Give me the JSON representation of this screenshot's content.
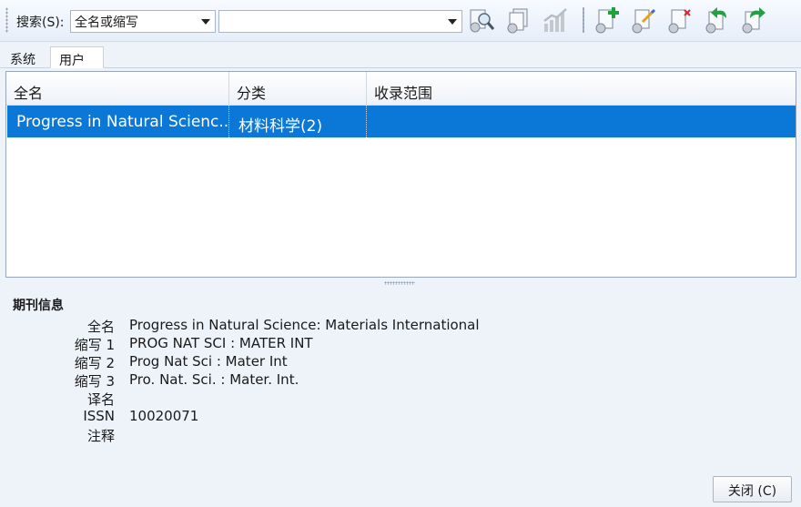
{
  "toolbar": {
    "search_label": "搜索(S):",
    "search_field_value": "全名或缩写",
    "search_text_value": "",
    "buttons": [
      {
        "name": "search-icon",
        "interactable": true
      },
      {
        "name": "copy-icon",
        "interactable": true
      },
      {
        "name": "chart-icon",
        "interactable": false
      },
      {
        "name": "add-icon",
        "interactable": true
      },
      {
        "name": "edit-icon",
        "interactable": true
      },
      {
        "name": "delete-icon",
        "interactable": true
      },
      {
        "name": "import-icon",
        "interactable": true
      },
      {
        "name": "export-icon",
        "interactable": true
      }
    ]
  },
  "tabs": [
    {
      "label": "系统",
      "active": false
    },
    {
      "label": "用户",
      "active": true
    }
  ],
  "table": {
    "columns": [
      "全名",
      "分类",
      "收录范围"
    ],
    "rows": [
      {
        "full_name": "Progress in Natural Scienc...",
        "category": "材料科学(2)",
        "scope": ""
      }
    ]
  },
  "info": {
    "title": "期刊信息",
    "fields": [
      {
        "label": "全名",
        "value": "Progress in Natural Science: Materials International"
      },
      {
        "label": "缩写 1",
        "value": "PROG NAT SCI : MATER INT"
      },
      {
        "label": "缩写 2",
        "value": "Prog Nat Sci : Mater Int"
      },
      {
        "label": "缩写 3",
        "value": "Pro. Nat. Sci. : Mater. Int."
      },
      {
        "label": "译名",
        "value": ""
      },
      {
        "label": "ISSN",
        "value": "10020071"
      },
      {
        "label": "注释",
        "value": ""
      }
    ]
  },
  "close_button": "关闭 (C)",
  "colors": {
    "selection": "#0b78d7",
    "background": "#eef3fa"
  }
}
